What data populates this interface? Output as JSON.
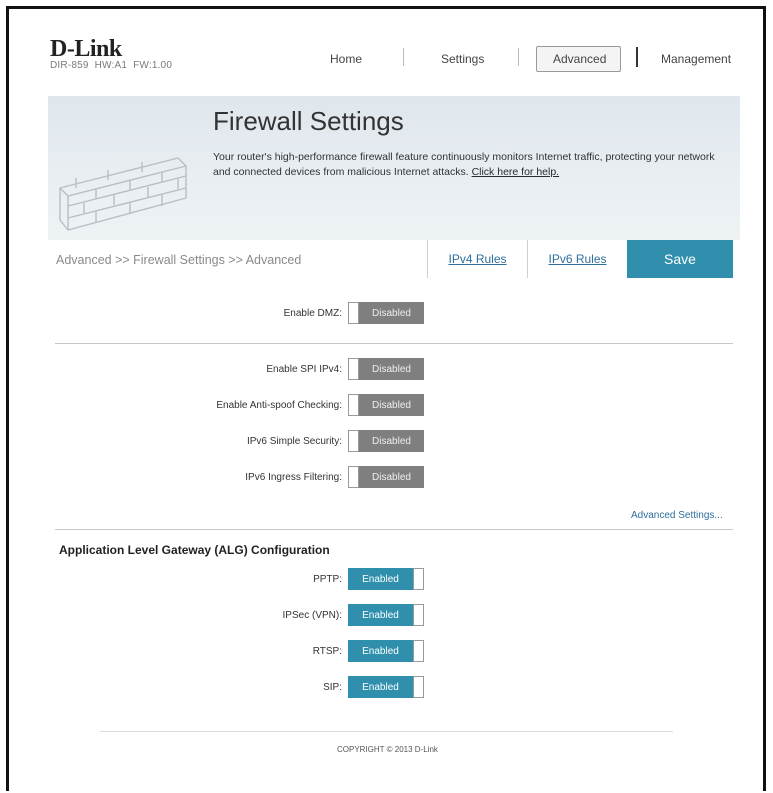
{
  "header": {
    "logo": "D-Link",
    "model": "DIR-859",
    "hw": "HW:A1",
    "fw": "FW:1.00",
    "nav": [
      "Home",
      "Settings",
      "Advanced",
      "Management"
    ],
    "active_nav": "Advanced"
  },
  "banner": {
    "title": "Firewall Settings",
    "description": "Your router's high-performance firewall feature continuously monitors Internet traffic, protecting your network and connected devices from malicious Internet attacks.",
    "help_link": "Click here for help."
  },
  "toolbar": {
    "breadcrumb": "Advanced >> Firewall Settings >> Advanced",
    "tab_ipv4": "IPv4 Rules",
    "tab_ipv6": "IPv6 Rules",
    "save_label": "Save"
  },
  "dmz": {
    "label": "Enable DMZ:",
    "state": "Disabled"
  },
  "security": [
    {
      "label": "Enable SPI IPv4:",
      "state": "Disabled"
    },
    {
      "label": "Enable Anti-spoof Checking:",
      "state": "Disabled"
    },
    {
      "label": "IPv6 Simple Security:",
      "state": "Disabled"
    },
    {
      "label": "IPv6 Ingress Filtering:",
      "state": "Disabled"
    }
  ],
  "advanced_settings_link": "Advanced Settings...",
  "alg": {
    "title": "Application Level Gateway (ALG) Configuration",
    "items": [
      {
        "label": "PPTP:",
        "state": "Enabled"
      },
      {
        "label": "IPSec (VPN):",
        "state": "Enabled"
      },
      {
        "label": "RTSP:",
        "state": "Enabled"
      },
      {
        "label": "SIP:",
        "state": "Enabled"
      }
    ]
  },
  "footer": {
    "copyright": "COPYRIGHT © 2013 D-Link"
  },
  "colors": {
    "accent": "#2f8fad",
    "disabled": "#7f7f7f",
    "link": "#2e6f9c"
  },
  "icons": {
    "banner": "brick-wall-icon"
  }
}
